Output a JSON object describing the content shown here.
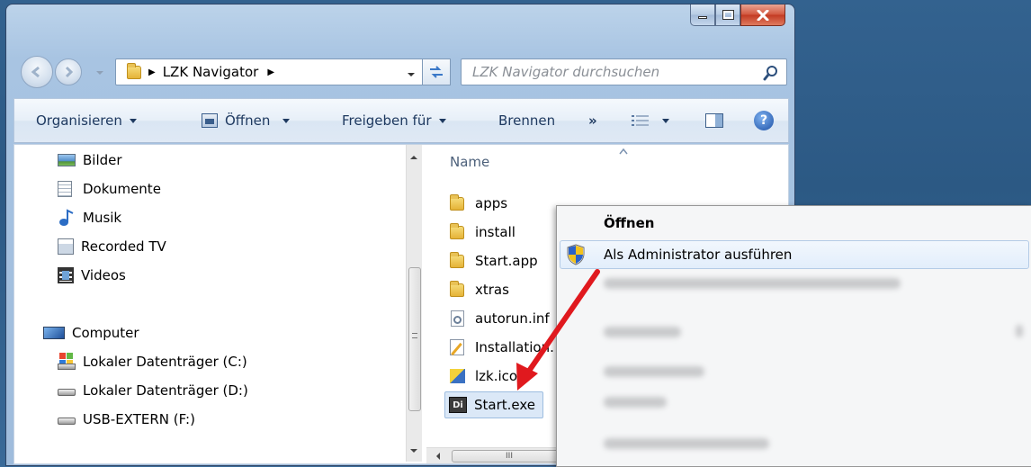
{
  "window": {
    "buttons": {
      "minimize": "minimize",
      "maximize": "maximize",
      "close": "close"
    }
  },
  "address": {
    "path": [
      "LZK Navigator"
    ],
    "search_placeholder": "LZK Navigator durchsuchen"
  },
  "toolbar": {
    "organize": "Organisieren",
    "open": "Öffnen",
    "share": "Freigeben für",
    "burn": "Brennen",
    "more": "»"
  },
  "nav_pane": {
    "libraries": [
      "Bilder",
      "Dokumente",
      "Musik",
      "Recorded TV",
      "Videos"
    ],
    "computer": "Computer",
    "drives": [
      "Lokaler Datenträger (C:)",
      "Lokaler Datenträger (D:)",
      "USB-EXTERN (F:)"
    ]
  },
  "file_pane": {
    "column_header": "Name",
    "files": [
      "apps",
      "install",
      "Start.app",
      "xtras",
      "autorun.inf",
      "Installation.",
      "lzk.ico",
      "Start.exe"
    ],
    "selected": "Start.exe",
    "hscroll_grip": "III"
  },
  "context_menu": {
    "items": [
      "Öffnen",
      "Als Administrator ausführen"
    ]
  },
  "colors": {
    "desktop": "#2c5984",
    "arrow": "#e0191e",
    "selection": "#dbe8f7"
  }
}
